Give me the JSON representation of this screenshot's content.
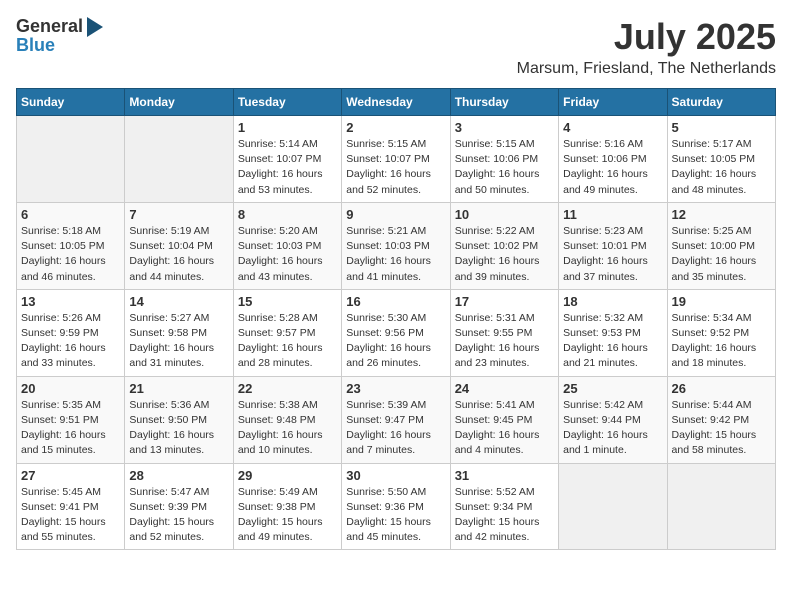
{
  "logo": {
    "general": "General",
    "blue": "Blue"
  },
  "title": "July 2025",
  "location": "Marsum, Friesland, The Netherlands",
  "headers": [
    "Sunday",
    "Monday",
    "Tuesday",
    "Wednesday",
    "Thursday",
    "Friday",
    "Saturday"
  ],
  "weeks": [
    [
      {
        "day": "",
        "info": ""
      },
      {
        "day": "",
        "info": ""
      },
      {
        "day": "1",
        "info": "Sunrise: 5:14 AM\nSunset: 10:07 PM\nDaylight: 16 hours and 53 minutes."
      },
      {
        "day": "2",
        "info": "Sunrise: 5:15 AM\nSunset: 10:07 PM\nDaylight: 16 hours and 52 minutes."
      },
      {
        "day": "3",
        "info": "Sunrise: 5:15 AM\nSunset: 10:06 PM\nDaylight: 16 hours and 50 minutes."
      },
      {
        "day": "4",
        "info": "Sunrise: 5:16 AM\nSunset: 10:06 PM\nDaylight: 16 hours and 49 minutes."
      },
      {
        "day": "5",
        "info": "Sunrise: 5:17 AM\nSunset: 10:05 PM\nDaylight: 16 hours and 48 minutes."
      }
    ],
    [
      {
        "day": "6",
        "info": "Sunrise: 5:18 AM\nSunset: 10:05 PM\nDaylight: 16 hours and 46 minutes."
      },
      {
        "day": "7",
        "info": "Sunrise: 5:19 AM\nSunset: 10:04 PM\nDaylight: 16 hours and 44 minutes."
      },
      {
        "day": "8",
        "info": "Sunrise: 5:20 AM\nSunset: 10:03 PM\nDaylight: 16 hours and 43 minutes."
      },
      {
        "day": "9",
        "info": "Sunrise: 5:21 AM\nSunset: 10:03 PM\nDaylight: 16 hours and 41 minutes."
      },
      {
        "day": "10",
        "info": "Sunrise: 5:22 AM\nSunset: 10:02 PM\nDaylight: 16 hours and 39 minutes."
      },
      {
        "day": "11",
        "info": "Sunrise: 5:23 AM\nSunset: 10:01 PM\nDaylight: 16 hours and 37 minutes."
      },
      {
        "day": "12",
        "info": "Sunrise: 5:25 AM\nSunset: 10:00 PM\nDaylight: 16 hours and 35 minutes."
      }
    ],
    [
      {
        "day": "13",
        "info": "Sunrise: 5:26 AM\nSunset: 9:59 PM\nDaylight: 16 hours and 33 minutes."
      },
      {
        "day": "14",
        "info": "Sunrise: 5:27 AM\nSunset: 9:58 PM\nDaylight: 16 hours and 31 minutes."
      },
      {
        "day": "15",
        "info": "Sunrise: 5:28 AM\nSunset: 9:57 PM\nDaylight: 16 hours and 28 minutes."
      },
      {
        "day": "16",
        "info": "Sunrise: 5:30 AM\nSunset: 9:56 PM\nDaylight: 16 hours and 26 minutes."
      },
      {
        "day": "17",
        "info": "Sunrise: 5:31 AM\nSunset: 9:55 PM\nDaylight: 16 hours and 23 minutes."
      },
      {
        "day": "18",
        "info": "Sunrise: 5:32 AM\nSunset: 9:53 PM\nDaylight: 16 hours and 21 minutes."
      },
      {
        "day": "19",
        "info": "Sunrise: 5:34 AM\nSunset: 9:52 PM\nDaylight: 16 hours and 18 minutes."
      }
    ],
    [
      {
        "day": "20",
        "info": "Sunrise: 5:35 AM\nSunset: 9:51 PM\nDaylight: 16 hours and 15 minutes."
      },
      {
        "day": "21",
        "info": "Sunrise: 5:36 AM\nSunset: 9:50 PM\nDaylight: 16 hours and 13 minutes."
      },
      {
        "day": "22",
        "info": "Sunrise: 5:38 AM\nSunset: 9:48 PM\nDaylight: 16 hours and 10 minutes."
      },
      {
        "day": "23",
        "info": "Sunrise: 5:39 AM\nSunset: 9:47 PM\nDaylight: 16 hours and 7 minutes."
      },
      {
        "day": "24",
        "info": "Sunrise: 5:41 AM\nSunset: 9:45 PM\nDaylight: 16 hours and 4 minutes."
      },
      {
        "day": "25",
        "info": "Sunrise: 5:42 AM\nSunset: 9:44 PM\nDaylight: 16 hours and 1 minute."
      },
      {
        "day": "26",
        "info": "Sunrise: 5:44 AM\nSunset: 9:42 PM\nDaylight: 15 hours and 58 minutes."
      }
    ],
    [
      {
        "day": "27",
        "info": "Sunrise: 5:45 AM\nSunset: 9:41 PM\nDaylight: 15 hours and 55 minutes."
      },
      {
        "day": "28",
        "info": "Sunrise: 5:47 AM\nSunset: 9:39 PM\nDaylight: 15 hours and 52 minutes."
      },
      {
        "day": "29",
        "info": "Sunrise: 5:49 AM\nSunset: 9:38 PM\nDaylight: 15 hours and 49 minutes."
      },
      {
        "day": "30",
        "info": "Sunrise: 5:50 AM\nSunset: 9:36 PM\nDaylight: 15 hours and 45 minutes."
      },
      {
        "day": "31",
        "info": "Sunrise: 5:52 AM\nSunset: 9:34 PM\nDaylight: 15 hours and 42 minutes."
      },
      {
        "day": "",
        "info": ""
      },
      {
        "day": "",
        "info": ""
      }
    ]
  ]
}
